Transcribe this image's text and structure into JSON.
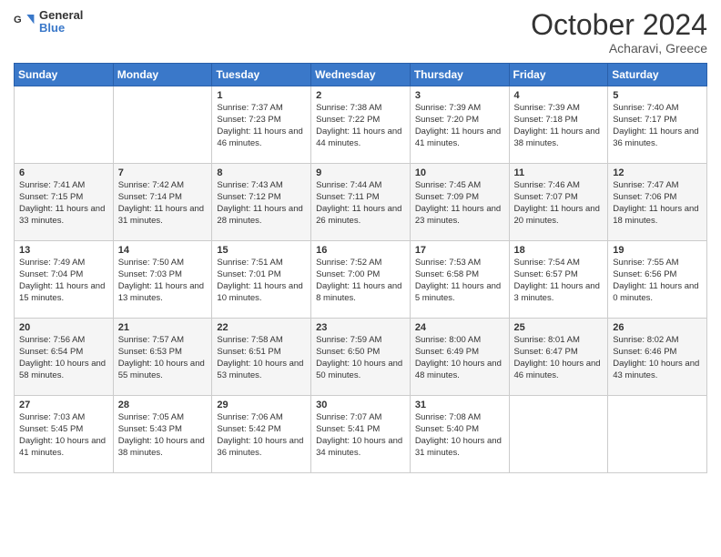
{
  "logo": {
    "line1": "General",
    "line2": "Blue"
  },
  "title": "October 2024",
  "location": "Acharavi, Greece",
  "days_header": [
    "Sunday",
    "Monday",
    "Tuesday",
    "Wednesday",
    "Thursday",
    "Friday",
    "Saturday"
  ],
  "weeks": [
    [
      {
        "day": "",
        "info": ""
      },
      {
        "day": "",
        "info": ""
      },
      {
        "day": "1",
        "info": "Sunrise: 7:37 AM\nSunset: 7:23 PM\nDaylight: 11 hours and 46 minutes."
      },
      {
        "day": "2",
        "info": "Sunrise: 7:38 AM\nSunset: 7:22 PM\nDaylight: 11 hours and 44 minutes."
      },
      {
        "day": "3",
        "info": "Sunrise: 7:39 AM\nSunset: 7:20 PM\nDaylight: 11 hours and 41 minutes."
      },
      {
        "day": "4",
        "info": "Sunrise: 7:39 AM\nSunset: 7:18 PM\nDaylight: 11 hours and 38 minutes."
      },
      {
        "day": "5",
        "info": "Sunrise: 7:40 AM\nSunset: 7:17 PM\nDaylight: 11 hours and 36 minutes."
      }
    ],
    [
      {
        "day": "6",
        "info": "Sunrise: 7:41 AM\nSunset: 7:15 PM\nDaylight: 11 hours and 33 minutes."
      },
      {
        "day": "7",
        "info": "Sunrise: 7:42 AM\nSunset: 7:14 PM\nDaylight: 11 hours and 31 minutes."
      },
      {
        "day": "8",
        "info": "Sunrise: 7:43 AM\nSunset: 7:12 PM\nDaylight: 11 hours and 28 minutes."
      },
      {
        "day": "9",
        "info": "Sunrise: 7:44 AM\nSunset: 7:11 PM\nDaylight: 11 hours and 26 minutes."
      },
      {
        "day": "10",
        "info": "Sunrise: 7:45 AM\nSunset: 7:09 PM\nDaylight: 11 hours and 23 minutes."
      },
      {
        "day": "11",
        "info": "Sunrise: 7:46 AM\nSunset: 7:07 PM\nDaylight: 11 hours and 20 minutes."
      },
      {
        "day": "12",
        "info": "Sunrise: 7:47 AM\nSunset: 7:06 PM\nDaylight: 11 hours and 18 minutes."
      }
    ],
    [
      {
        "day": "13",
        "info": "Sunrise: 7:49 AM\nSunset: 7:04 PM\nDaylight: 11 hours and 15 minutes."
      },
      {
        "day": "14",
        "info": "Sunrise: 7:50 AM\nSunset: 7:03 PM\nDaylight: 11 hours and 13 minutes."
      },
      {
        "day": "15",
        "info": "Sunrise: 7:51 AM\nSunset: 7:01 PM\nDaylight: 11 hours and 10 minutes."
      },
      {
        "day": "16",
        "info": "Sunrise: 7:52 AM\nSunset: 7:00 PM\nDaylight: 11 hours and 8 minutes."
      },
      {
        "day": "17",
        "info": "Sunrise: 7:53 AM\nSunset: 6:58 PM\nDaylight: 11 hours and 5 minutes."
      },
      {
        "day": "18",
        "info": "Sunrise: 7:54 AM\nSunset: 6:57 PM\nDaylight: 11 hours and 3 minutes."
      },
      {
        "day": "19",
        "info": "Sunrise: 7:55 AM\nSunset: 6:56 PM\nDaylight: 11 hours and 0 minutes."
      }
    ],
    [
      {
        "day": "20",
        "info": "Sunrise: 7:56 AM\nSunset: 6:54 PM\nDaylight: 10 hours and 58 minutes."
      },
      {
        "day": "21",
        "info": "Sunrise: 7:57 AM\nSunset: 6:53 PM\nDaylight: 10 hours and 55 minutes."
      },
      {
        "day": "22",
        "info": "Sunrise: 7:58 AM\nSunset: 6:51 PM\nDaylight: 10 hours and 53 minutes."
      },
      {
        "day": "23",
        "info": "Sunrise: 7:59 AM\nSunset: 6:50 PM\nDaylight: 10 hours and 50 minutes."
      },
      {
        "day": "24",
        "info": "Sunrise: 8:00 AM\nSunset: 6:49 PM\nDaylight: 10 hours and 48 minutes."
      },
      {
        "day": "25",
        "info": "Sunrise: 8:01 AM\nSunset: 6:47 PM\nDaylight: 10 hours and 46 minutes."
      },
      {
        "day": "26",
        "info": "Sunrise: 8:02 AM\nSunset: 6:46 PM\nDaylight: 10 hours and 43 minutes."
      }
    ],
    [
      {
        "day": "27",
        "info": "Sunrise: 7:03 AM\nSunset: 5:45 PM\nDaylight: 10 hours and 41 minutes."
      },
      {
        "day": "28",
        "info": "Sunrise: 7:05 AM\nSunset: 5:43 PM\nDaylight: 10 hours and 38 minutes."
      },
      {
        "day": "29",
        "info": "Sunrise: 7:06 AM\nSunset: 5:42 PM\nDaylight: 10 hours and 36 minutes."
      },
      {
        "day": "30",
        "info": "Sunrise: 7:07 AM\nSunset: 5:41 PM\nDaylight: 10 hours and 34 minutes."
      },
      {
        "day": "31",
        "info": "Sunrise: 7:08 AM\nSunset: 5:40 PM\nDaylight: 10 hours and 31 minutes."
      },
      {
        "day": "",
        "info": ""
      },
      {
        "day": "",
        "info": ""
      }
    ]
  ]
}
